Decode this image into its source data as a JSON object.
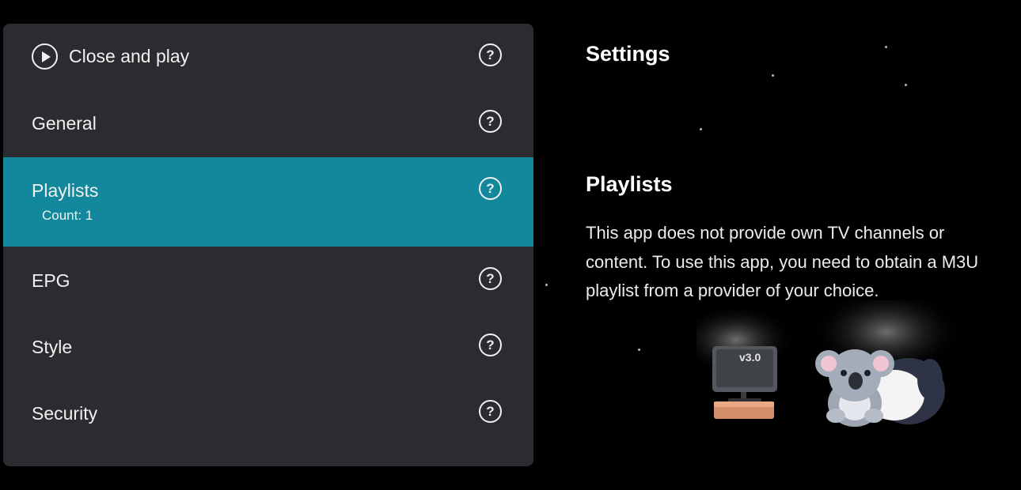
{
  "menu": {
    "items": [
      {
        "label": "Close and play",
        "icon": "play-circle-icon",
        "help_icon": "question-icon"
      },
      {
        "label": "General",
        "help_icon": "question-icon"
      },
      {
        "label": "Playlists",
        "sublabel": "Count: 1",
        "help_icon": "question-icon",
        "selected": true
      },
      {
        "label": "EPG",
        "help_icon": "question-icon"
      },
      {
        "label": "Style",
        "help_icon": "question-icon"
      },
      {
        "label": "Security",
        "help_icon": "question-icon"
      }
    ],
    "help_symbol": "?"
  },
  "detail": {
    "page_title": "Settings",
    "section_title": "Playlists",
    "description": "This app does not provide own TV channels or content. To use this app, you need to obtain a M3U playlist from a provider of your choice."
  },
  "illustration": {
    "tv_badge": "v3.0"
  },
  "colors": {
    "background": "#000000",
    "panel": "#2b2c2f",
    "selected": "#13889c",
    "text": "#f0f0f0"
  }
}
